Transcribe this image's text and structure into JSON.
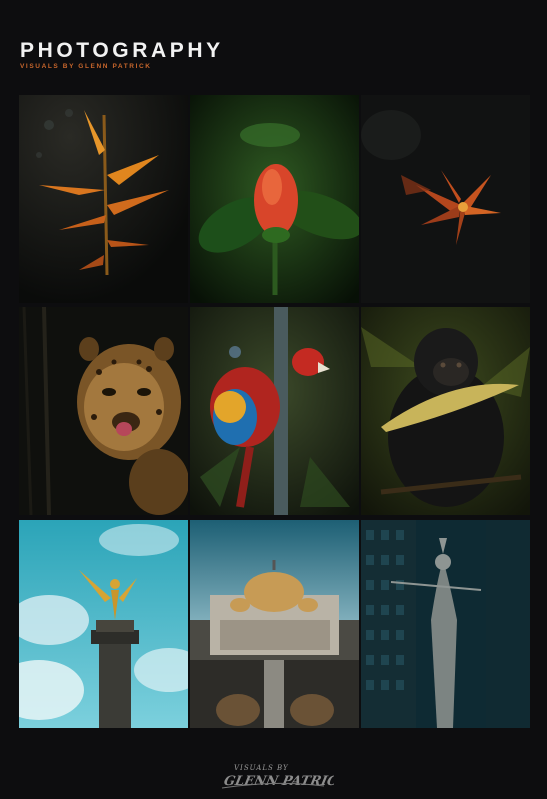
{
  "header": {
    "title": "PHOTOGRAPHY",
    "subtitle": "VISUALS BY GLENN PATRICK"
  },
  "photos": [
    {
      "subject": "heliconia-flower"
    },
    {
      "subject": "red-flower-bud"
    },
    {
      "subject": "orange-lily"
    },
    {
      "subject": "jaguar"
    },
    {
      "subject": "scarlet-macaw"
    },
    {
      "subject": "howler-monkey"
    },
    {
      "subject": "angel-of-independence"
    },
    {
      "subject": "palacio-de-bellas-artes"
    },
    {
      "subject": "statue-between-buildings"
    }
  ],
  "signature": {
    "line1": "VISUALS BY",
    "line2": "GLENN PATRICK"
  },
  "colors": {
    "background": "#0d0d0f",
    "accent": "#c8662c",
    "title": "#f2f2f2"
  }
}
